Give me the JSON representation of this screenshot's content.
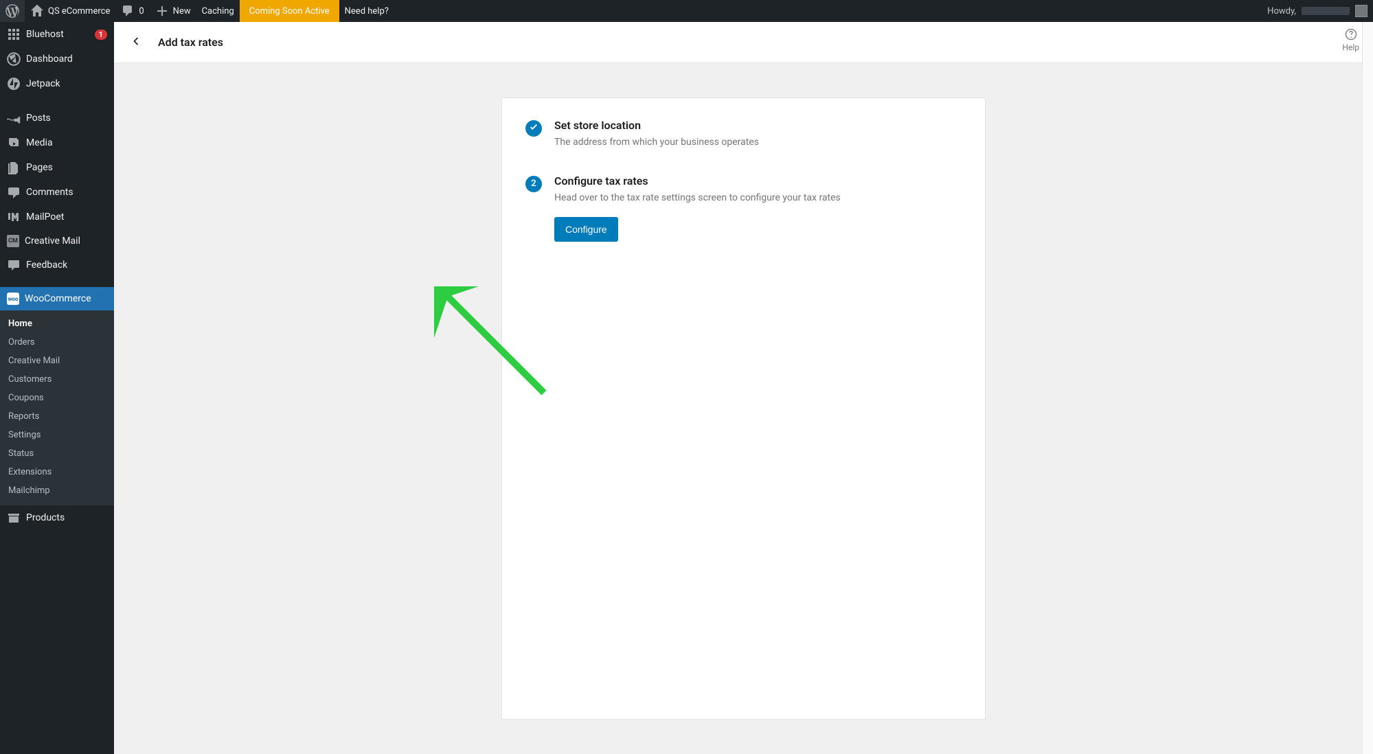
{
  "adminbar": {
    "site_name": "QS eCommerce",
    "comment_count": "0",
    "new_label": "New",
    "caching_label": "Caching",
    "coming_soon_label": "Coming Soon Active",
    "need_help_label": "Need help?",
    "howdy": "Howdy,"
  },
  "sidebar": {
    "items": [
      {
        "id": "bluehost",
        "label": "Bluehost",
        "icon": "grid",
        "badge": "1"
      },
      {
        "id": "dashboard",
        "label": "Dashboard",
        "icon": "gauge"
      },
      {
        "id": "jetpack",
        "label": "Jetpack",
        "icon": "jetpack"
      },
      {
        "id": "posts",
        "label": "Posts",
        "icon": "pin",
        "section_break": true
      },
      {
        "id": "media",
        "label": "Media",
        "icon": "media"
      },
      {
        "id": "pages",
        "label": "Pages",
        "icon": "pages"
      },
      {
        "id": "comments",
        "label": "Comments",
        "icon": "comment"
      },
      {
        "id": "mailpoet",
        "label": "MailPoet",
        "icon": "mailpoet"
      },
      {
        "id": "creative-mail",
        "label": "Creative Mail",
        "icon": "cmbox"
      },
      {
        "id": "feedback",
        "label": "Feedback",
        "icon": "feedback"
      },
      {
        "id": "woocommerce",
        "label": "WooCommerce",
        "icon": "woo",
        "current": true,
        "section_break": true
      },
      {
        "id": "products",
        "label": "Products",
        "icon": "archive",
        "section_break": true
      }
    ],
    "woocommerce_submenu": [
      {
        "id": "home",
        "label": "Home",
        "active": true
      },
      {
        "id": "orders",
        "label": "Orders"
      },
      {
        "id": "creative-mail",
        "label": "Creative Mail"
      },
      {
        "id": "customers",
        "label": "Customers"
      },
      {
        "id": "coupons",
        "label": "Coupons"
      },
      {
        "id": "reports",
        "label": "Reports"
      },
      {
        "id": "settings",
        "label": "Settings"
      },
      {
        "id": "status",
        "label": "Status"
      },
      {
        "id": "extensions",
        "label": "Extensions"
      },
      {
        "id": "mailchimp",
        "label": "Mailchimp"
      }
    ]
  },
  "page": {
    "title": "Add tax rates",
    "help_label": "Help"
  },
  "steps": [
    {
      "badge": "check",
      "title": "Set store location",
      "desc": "The address from which your business operates"
    },
    {
      "badge": "2",
      "title": "Configure tax rates",
      "desc": "Head over to the tax rate settings screen to configure your tax rates",
      "action_label": "Configure"
    }
  ]
}
